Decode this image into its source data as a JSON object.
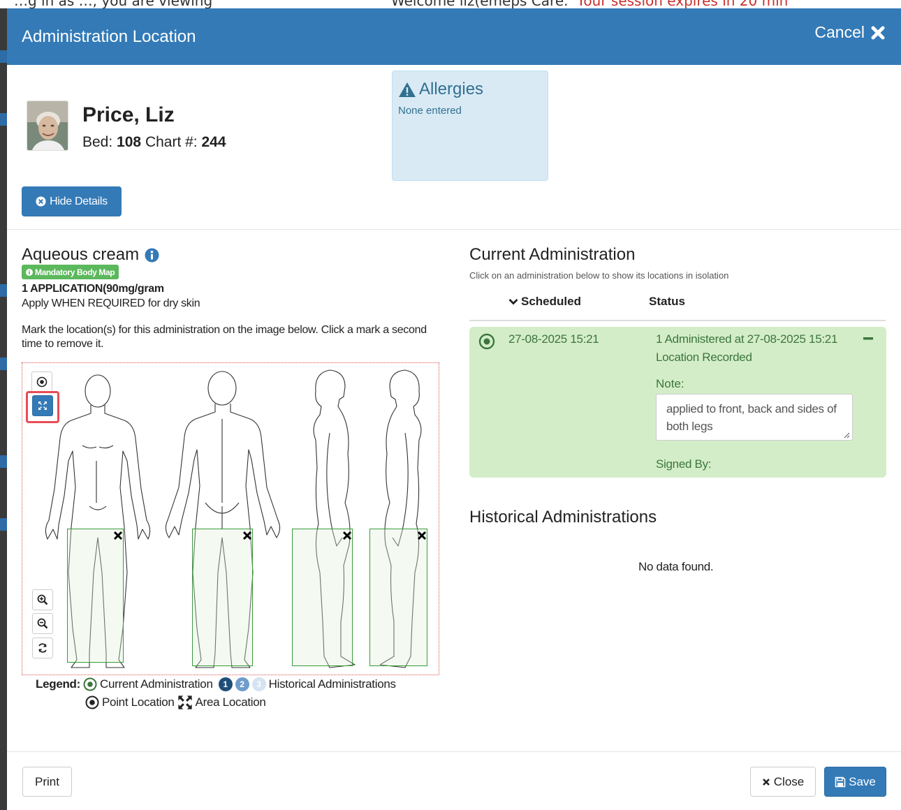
{
  "background": {
    "left_text": "…g in as …, you are viewing",
    "welcome_text": "Welcome liz(emeps Care.",
    "expires_text": "Your session expires in 20 min"
  },
  "modal": {
    "title": "Administration Location",
    "cancel_label": "Cancel"
  },
  "patient": {
    "name": "Price, Liz",
    "bed_label": "Bed:",
    "bed": "108",
    "chart_label": "Chart #:",
    "chart": "244"
  },
  "allergies": {
    "title": "Allergies",
    "value": "None entered"
  },
  "hide_details_label": "Hide Details",
  "medication": {
    "name": "Aqueous cream",
    "badge": "Mandatory Body Map",
    "dose": "1 APPLICATION(90mg/gram",
    "directions": "Apply WHEN REQUIRED for dry skin",
    "instructions": "Mark the location(s) for this administration on the image below. Click a mark a second time to remove it."
  },
  "legend": {
    "label": "Legend:",
    "current": "Current Administration",
    "historical_numbers": [
      "1",
      "2",
      "3"
    ],
    "historical": "Historical Administrations",
    "point": "Point Location",
    "area": "Area Location"
  },
  "current_administration": {
    "title": "Current Administration",
    "subtitle": "Click on an administration below to show its locations in isolation",
    "col_scheduled": "Scheduled",
    "col_status": "Status",
    "row": {
      "scheduled": "27-08-2025 15:21",
      "status": "1 Administered at 27-08-2025 15:21",
      "location": "Location Recorded",
      "note_label": "Note:",
      "note": "applied to front, back and sides of both legs",
      "signed_by": "Signed By:"
    }
  },
  "historical": {
    "title": "Historical Administrations",
    "empty": "No data found."
  },
  "footer": {
    "print": "Print",
    "close": "Close",
    "save": "Save"
  },
  "colors": {
    "header_blue": "#337ab7",
    "success_green_bg": "#d4edc9",
    "success_green_text": "#3c763d",
    "badge_green": "#5cb85c",
    "allergy_bg": "#d9eaf5",
    "highlight_red": "#e84c55"
  },
  "icons": [
    "times-icon",
    "warning-icon",
    "times-circle-icon",
    "info-circle-icon",
    "point-location-icon",
    "area-location-icon",
    "zoom-in-icon",
    "zoom-out-icon",
    "refresh-icon",
    "chevron-down-icon",
    "remove-area-icon",
    "minus-icon",
    "close-icon",
    "save-icon"
  ]
}
